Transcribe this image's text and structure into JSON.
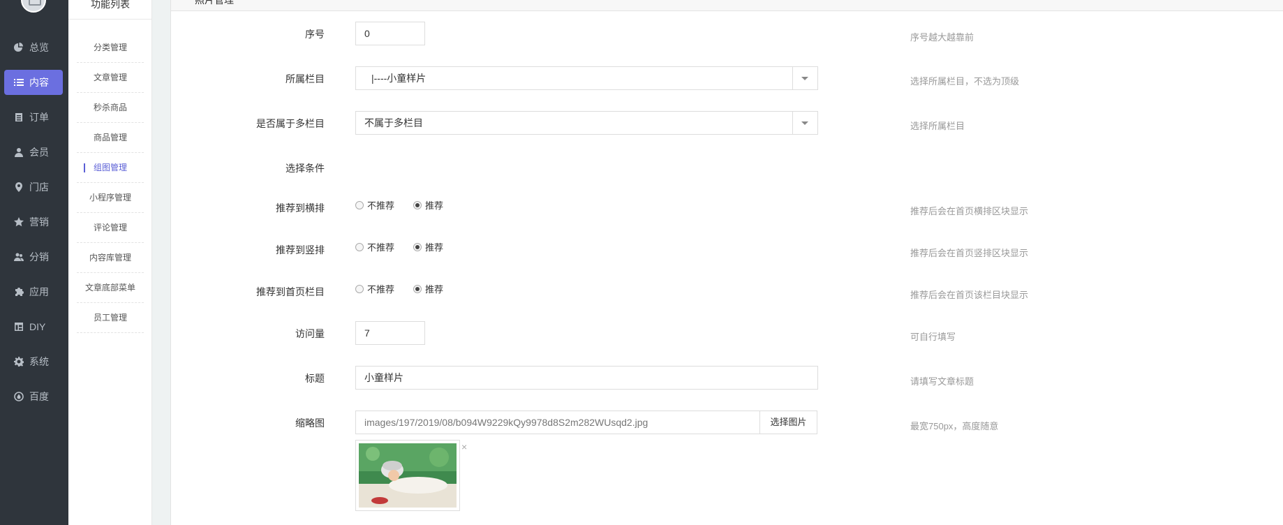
{
  "nav": {
    "items": [
      {
        "label": "总览",
        "icon": "pie-chart-icon"
      },
      {
        "label": "内容",
        "icon": "list-icon"
      },
      {
        "label": "订单",
        "icon": "order-icon"
      },
      {
        "label": "会员",
        "icon": "user-icon"
      },
      {
        "label": "门店",
        "icon": "location-pin-icon"
      },
      {
        "label": "营销",
        "icon": "star-icon"
      },
      {
        "label": "分销",
        "icon": "users-icon"
      },
      {
        "label": "应用",
        "icon": "puzzle-icon"
      },
      {
        "label": "DIY",
        "icon": "layout-icon"
      },
      {
        "label": "系统",
        "icon": "gear-icon"
      },
      {
        "label": "百度",
        "icon": "baidu-icon"
      }
    ],
    "active_index": 1
  },
  "submenu": {
    "title": "功能列表",
    "items": [
      "分类管理",
      "文章管理",
      "秒杀商品",
      "商品管理",
      "组图管理",
      "小程序管理",
      "评论管理",
      "内容库管理",
      "文章底部菜单",
      "员工管理"
    ],
    "active_index": 4
  },
  "panel": {
    "title": "照片管理"
  },
  "form": {
    "order": {
      "label": "序号",
      "value": "0",
      "help": "序号越大越靠前"
    },
    "column": {
      "label": "所属栏目",
      "value": "|----小童样片",
      "help": "选择所属栏目，不选为顶级"
    },
    "multi_column": {
      "label": "是否属于多栏目",
      "value": "不属于多栏目",
      "help": "选择所属栏目"
    },
    "conditions": {
      "label": "选择条件"
    },
    "recommend_horizontal": {
      "label": "推荐到横排",
      "options": [
        "不推荐",
        "推荐"
      ],
      "selected": "推荐",
      "help": "推荐后会在首页横排区块显示"
    },
    "recommend_vertical": {
      "label": "推荐到竖排",
      "options": [
        "不推荐",
        "推荐"
      ],
      "selected": "推荐",
      "help": "推荐后会在首页竖排区块显示"
    },
    "recommend_home": {
      "label": "推荐到首页栏目",
      "options": [
        "不推荐",
        "推荐"
      ],
      "selected": "推荐",
      "help": "推荐后会在首页该栏目块显示"
    },
    "visits": {
      "label": "访问量",
      "value": "7",
      "help": "可自行填写"
    },
    "title": {
      "label": "标题",
      "value": "小童样片",
      "help": "请填写文章标题"
    },
    "thumbnail": {
      "label": "缩略图",
      "value": "images/197/2019/08/b094W9229kQy9978d8S2m282WUsqd2.jpg",
      "button": "选择图片",
      "help": "最宽750px，高度随意",
      "remove": "×"
    }
  }
}
